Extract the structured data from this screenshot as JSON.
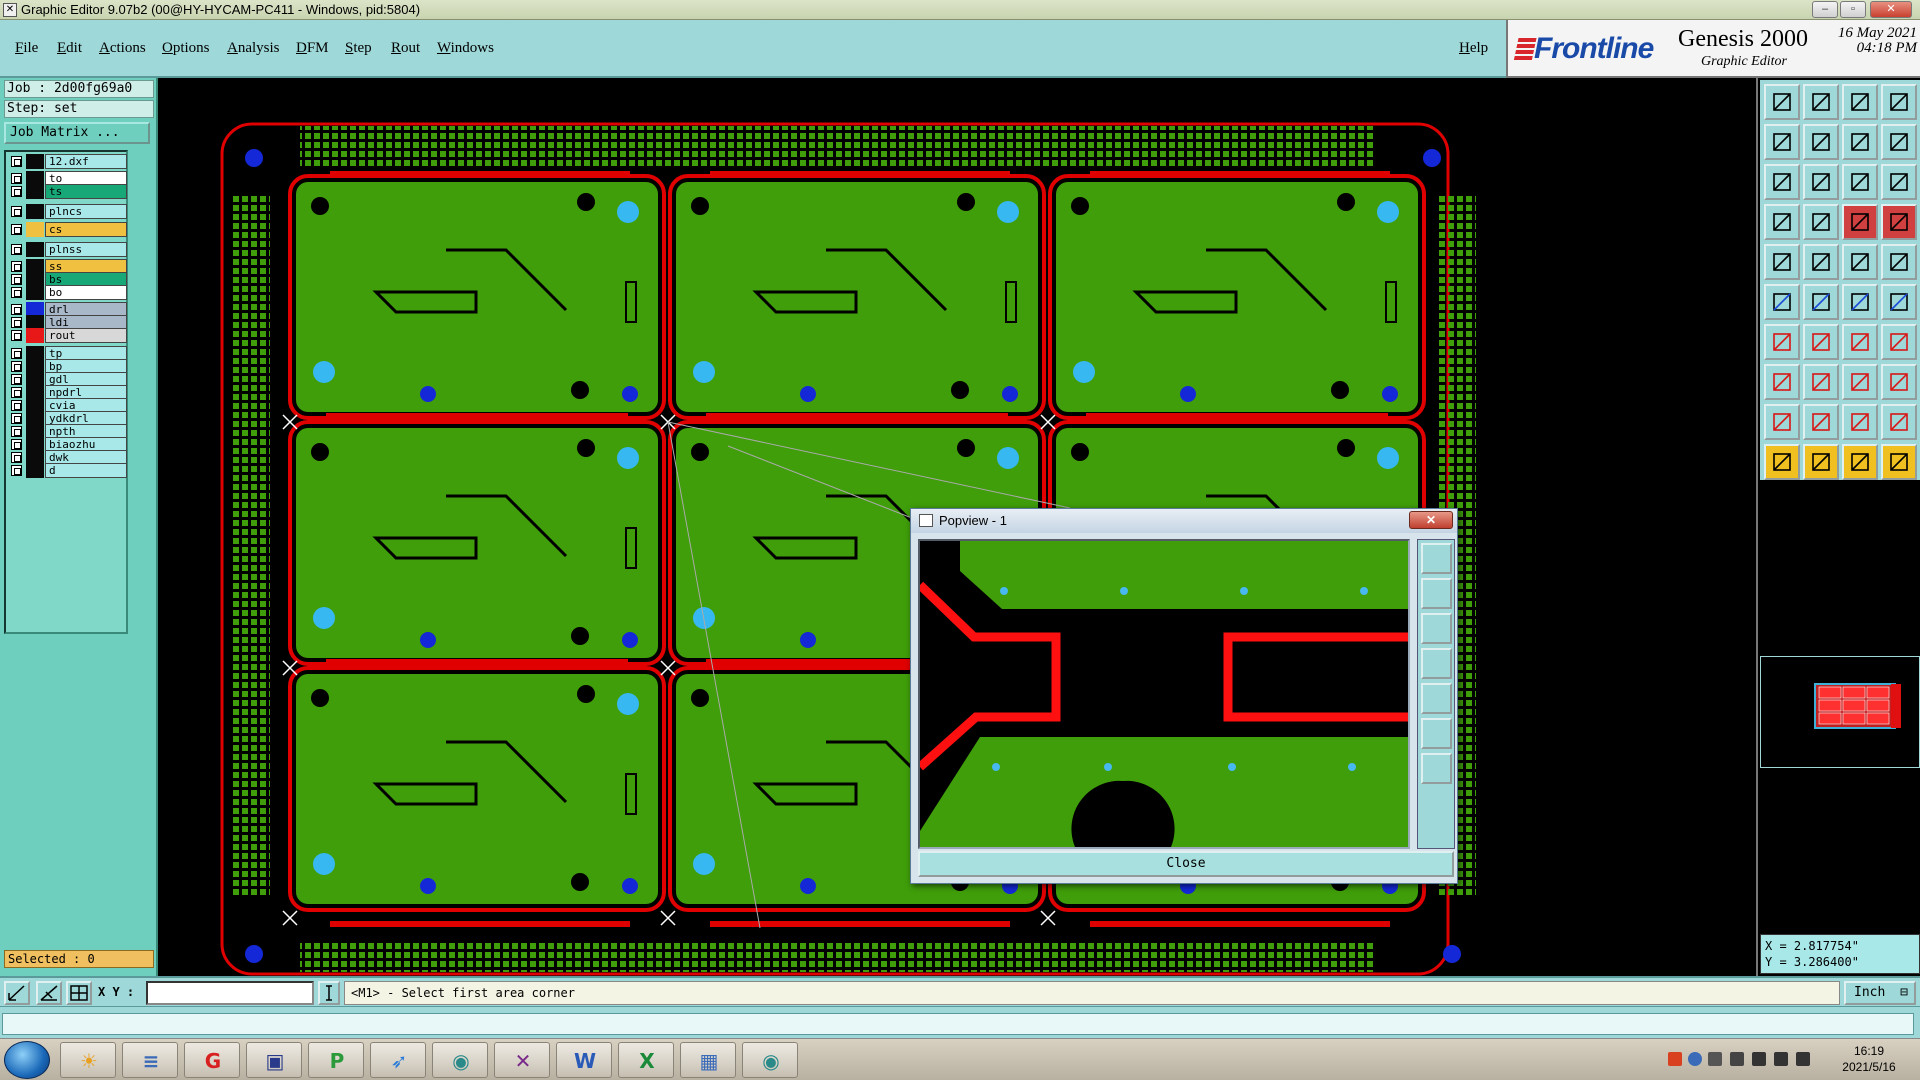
{
  "window": {
    "title": "Graphic Editor 9.07b2 (00@HY-HYCAM-PC411 - Windows, pid:5804)",
    "controls": [
      "minimize",
      "maximize",
      "close"
    ]
  },
  "menu": {
    "items": [
      "File",
      "Edit",
      "Actions",
      "Options",
      "Analysis",
      "DFM",
      "Step",
      "Rout",
      "Windows"
    ],
    "help": "Help"
  },
  "logo": {
    "brand": "Frontline",
    "product": "Genesis 2000",
    "subtitle": "Graphic Editor",
    "date": "16 May 2021",
    "time": "04:18 PM"
  },
  "job": {
    "job_line": "Job : 2d00fg69a0",
    "step_line": "Step: set",
    "job_matrix_label": "Job Matrix ..."
  },
  "layers": [
    {
      "name": "12.dxf",
      "color": "#0a0a0a",
      "label_bg": "#a8e8e8"
    },
    {
      "name": "to",
      "color": "#0a0a0a",
      "label_bg": "#ffffff"
    },
    {
      "name": "ts",
      "color": "#0a0a0a",
      "label_bg": "#18a878"
    },
    {
      "name": "plncs",
      "color": "#0a0a0a",
      "label_bg": "#a8e8e8"
    },
    {
      "name": "cs",
      "color": "#f0c040",
      "label_bg": "#f0c040"
    },
    {
      "name": "plnss",
      "color": "#0a0a0a",
      "label_bg": "#a8e8e8"
    },
    {
      "name": "ss",
      "color": "#0a0a0a",
      "label_bg": "#f0c040"
    },
    {
      "name": "bs",
      "color": "#0a0a0a",
      "label_bg": "#18a878"
    },
    {
      "name": "bo",
      "color": "#0a0a0a",
      "label_bg": "#ffffff"
    },
    {
      "name": "drl",
      "color": "#1428d8",
      "label_bg": "#a8b8c8"
    },
    {
      "name": "ldi",
      "color": "#0a0a0a",
      "label_bg": "#a8b8c8"
    },
    {
      "name": "rout",
      "color": "#e81818",
      "label_bg": "#d8d8d8"
    },
    {
      "name": "tp",
      "color": "#0a0a0a",
      "label_bg": "#a8e8e8"
    },
    {
      "name": "bp",
      "color": "#0a0a0a",
      "label_bg": "#a8e8e8"
    },
    {
      "name": "gdl",
      "color": "#0a0a0a",
      "label_bg": "#a8e8e8"
    },
    {
      "name": "npdrl",
      "color": "#0a0a0a",
      "label_bg": "#a8e8e8"
    },
    {
      "name": "cvia",
      "color": "#0a0a0a",
      "label_bg": "#a8e8e8"
    },
    {
      "name": "ydkdrl",
      "color": "#0a0a0a",
      "label_bg": "#a8e8e8"
    },
    {
      "name": "npth",
      "color": "#0a0a0a",
      "label_bg": "#a8e8e8"
    },
    {
      "name": "biaozhu",
      "color": "#0a0a0a",
      "label_bg": "#a8e8e8"
    },
    {
      "name": "dwk",
      "color": "#0a0a0a",
      "label_bg": "#a8e8e8"
    },
    {
      "name": "d",
      "color": "#0a0a0a",
      "label_bg": "#a8e8e8"
    }
  ],
  "selected_text": "Selected : 0",
  "status": {
    "xy_label": "X Y :",
    "xy_value": "",
    "prompt": "<M1> - Select first area corner",
    "units": "Inch"
  },
  "coords": {
    "x": "X = 2.817754\"",
    "y": "Y = 3.286400\""
  },
  "popview": {
    "title": "Popview - 1",
    "close_label": "Close",
    "close_x": "✕"
  },
  "taskbar": {
    "time": "16:19",
    "date": "2021/5/16",
    "apps": [
      "sun-app",
      "notepad",
      "g-app",
      "save-disk",
      "p-app",
      "feather-app",
      "fish-app",
      "x-app",
      "word",
      "excel",
      "image-viewer",
      "fish-app-2"
    ]
  },
  "colors": {
    "board_green": "#3f9e0a",
    "rout_red": "#e00000",
    "drill_blue": "#1428d8",
    "pad_cyan": "#38b8f0",
    "ui_teal": "#9ed8d8"
  }
}
